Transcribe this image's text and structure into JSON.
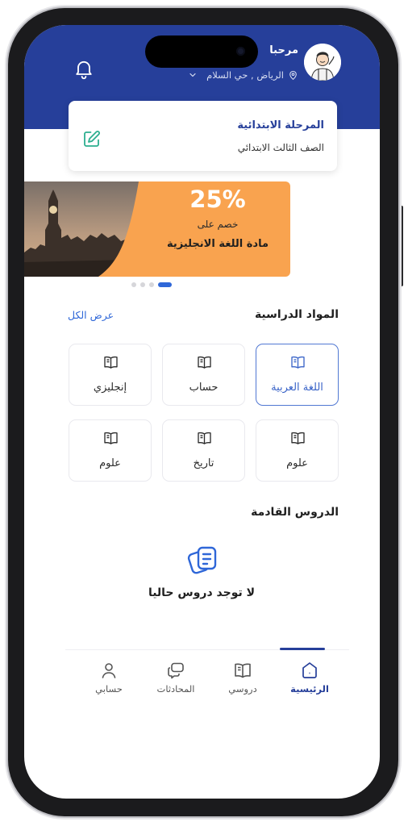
{
  "header": {
    "greeting": "مرحبا",
    "location": "الرياض , حي السلام",
    "background_color": "#263f9a"
  },
  "level_card": {
    "title": "المرحلة الابتدائية",
    "subtitle": "الصف الثالث الابتدائي",
    "edit_icon": "edit-icon"
  },
  "banner": {
    "discount": "25%",
    "line2": "خصم على",
    "line3": "مادة اللغة الانجليزية",
    "background_color": "#f9a34f"
  },
  "carousel": {
    "dot_count": 4,
    "active_index": 3
  },
  "subjects": {
    "title": "المواد الدراسية",
    "view_all": "عرض الكل",
    "items": [
      {
        "label": "اللغة العربية",
        "icon": "book-icon",
        "selected": true
      },
      {
        "label": "حساب",
        "icon": "book-icon",
        "selected": false
      },
      {
        "label": "إنجليزي",
        "icon": "book-icon",
        "selected": false
      },
      {
        "label": "علوم",
        "icon": "book-icon",
        "selected": false
      },
      {
        "label": "تاريخ",
        "icon": "book-icon",
        "selected": false
      },
      {
        "label": "علوم",
        "icon": "book-icon",
        "selected": false
      }
    ]
  },
  "upcoming": {
    "title": "الدروس القادمة",
    "empty_text": "لا توجد دروس حاليا",
    "empty_icon": "document-icon"
  },
  "tabbar": {
    "items": [
      {
        "label": "الرئيسية",
        "icon": "home-icon",
        "active": true
      },
      {
        "label": "دروسي",
        "icon": "book-icon",
        "active": false
      },
      {
        "label": "المحادثات",
        "icon": "chat-icon",
        "active": false
      },
      {
        "label": "حسابي",
        "icon": "user-icon",
        "active": false
      }
    ]
  },
  "colors": {
    "primary": "#263f9a",
    "accent": "#2f67d8",
    "banner_orange": "#f9a34f"
  }
}
